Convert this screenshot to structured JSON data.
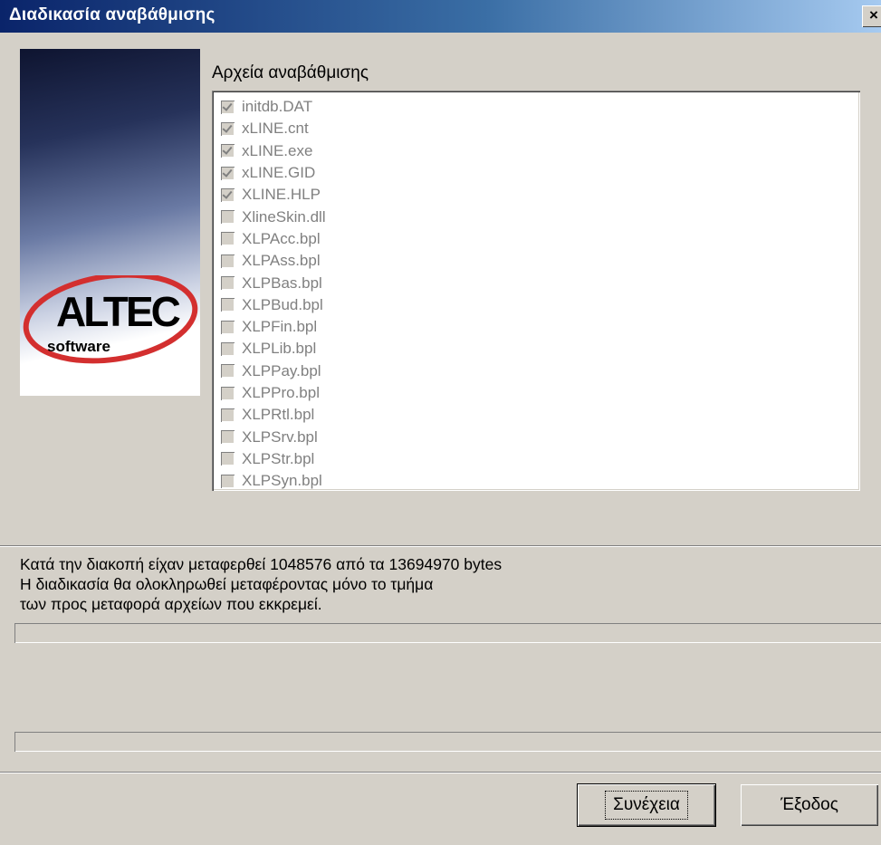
{
  "window": {
    "title": "Διαδικασία αναβάθμισης",
    "close_glyph": "×"
  },
  "logo": {
    "brand": "ALTEC",
    "tagline": "software"
  },
  "files": {
    "label": "Αρχεία αναβάθμισης",
    "items": [
      {
        "name": "initdb.DAT",
        "checked": true
      },
      {
        "name": "xLINE.cnt",
        "checked": true
      },
      {
        "name": "xLINE.exe",
        "checked": true
      },
      {
        "name": "xLINE.GID",
        "checked": true
      },
      {
        "name": "XLINE.HLP",
        "checked": true
      },
      {
        "name": "XlineSkin.dll",
        "checked": false
      },
      {
        "name": "XLPAcc.bpl",
        "checked": false
      },
      {
        "name": "XLPAss.bpl",
        "checked": false
      },
      {
        "name": "XLPBas.bpl",
        "checked": false
      },
      {
        "name": "XLPBud.bpl",
        "checked": false
      },
      {
        "name": "XLPFin.bpl",
        "checked": false
      },
      {
        "name": "XLPLib.bpl",
        "checked": false
      },
      {
        "name": "XLPPay.bpl",
        "checked": false
      },
      {
        "name": "XLPPro.bpl",
        "checked": false
      },
      {
        "name": "XLPRtl.bpl",
        "checked": false
      },
      {
        "name": "XLPSrv.bpl",
        "checked": false
      },
      {
        "name": "XLPStr.bpl",
        "checked": false
      },
      {
        "name": "XLPSyn.bpl",
        "checked": false
      }
    ]
  },
  "status": {
    "line1": "Κατά την διακοπή είχαν μεταφερθεί 1048576 από τα 13694970 bytes",
    "line2": "Η διαδικασία θα ολοκληρωθεί μεταφέροντας μόνο το τμήμα",
    "line3": "των προς μεταφορά αρχείων που εκκρεμεί."
  },
  "progress": {
    "file_fraction": 0,
    "total_fraction": 0
  },
  "buttons": {
    "continue": "Συνέχεια",
    "exit": "Έξοδος"
  },
  "colors": {
    "title_start": "#0a246a",
    "title_end": "#a6caf0",
    "face": "#d4d0c8",
    "logo_red": "#d32f2f"
  }
}
